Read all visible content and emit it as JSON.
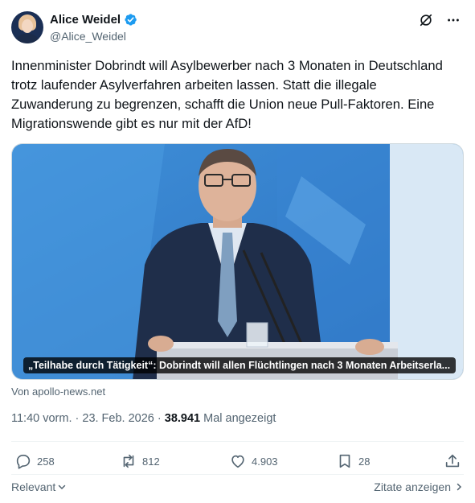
{
  "author": {
    "name": "Alice Weidel",
    "handle": "@Alice_Weidel",
    "verified_color": "#1d9bf0"
  },
  "tweet": {
    "text": "Innenminister Dobrindt will Asylbewerber nach 3 Monaten in Deutschland trotz laufender Asylverfahren arbeiten lassen. Statt die illegale Zuwanderung zu begrenzen, schafft die Union neue Pull-Faktoren. Eine Migrationswende gibt es nur mit der AfD!",
    "link_caption": "„Teilhabe durch Tätigkeit“: Dobrindt will allen Flüchtlingen nach 3 Monaten Arbeitserla...",
    "source": "Von apollo-news.net"
  },
  "meta": {
    "time_date": "11:40 vorm. · 23. Feb. 2026 · ",
    "views_count": "38.941",
    "views_label": " Mal angezeigt"
  },
  "actions": {
    "replies": "258",
    "reposts": "812",
    "likes": "4.903",
    "bookmarks": "28"
  },
  "footer": {
    "relevant_label": "Relevant",
    "quotes_label": "Zitate anzeigen"
  },
  "icons": {
    "top_right": [
      "grok-slash-icon",
      "more-icon"
    ],
    "actions": [
      "reply-icon",
      "repost-icon",
      "like-icon",
      "bookmark-icon",
      "share-icon"
    ]
  },
  "colors": {
    "text_primary": "#0f1419",
    "text_secondary": "#536471",
    "accent": "#1d9bf0"
  }
}
